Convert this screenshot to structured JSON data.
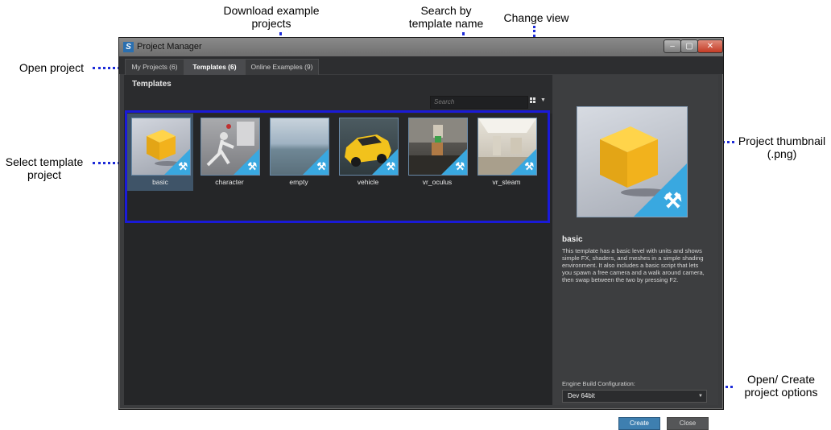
{
  "callouts": {
    "download": "Download example\nprojects",
    "search": "Search by\ntemplate name",
    "change_view": "Change view",
    "open_project": "Open project",
    "select_template": "Select template\nproject",
    "thumbnail": "Project thumbnail\n(.png)",
    "open_create": "Open/ Create\nproject options"
  },
  "window": {
    "title": "Project Manager",
    "icon": "app-logo-icon",
    "controls": [
      "minimize-icon",
      "maximize-icon",
      "close-icon"
    ]
  },
  "tabs": [
    {
      "label": "My Projects (6)",
      "active": false
    },
    {
      "label": "Templates (6)",
      "active": true
    },
    {
      "label": "Online Examples (9)",
      "active": false
    }
  ],
  "left": {
    "heading": "Templates",
    "search_placeholder": "Search",
    "view_icon": "grid-view-icon"
  },
  "templates": [
    {
      "label": "basic",
      "selected": true
    },
    {
      "label": "character",
      "selected": false
    },
    {
      "label": "empty",
      "selected": false
    },
    {
      "label": "vehicle",
      "selected": false
    },
    {
      "label": "vr_oculus",
      "selected": false
    },
    {
      "label": "vr_steam",
      "selected": false
    }
  ],
  "details": {
    "title": "basic",
    "description": "This template has a basic level with units and shows simple FX, shaders, and meshes in a simple shading environment. It also includes a basic script that lets you spawn a free camera and a walk around camera, then swap between the two by pressing F2.",
    "engine_label": "Engine Build Configuration:",
    "engine_value": "Dev 64bit",
    "create_label": "Create",
    "close_label": "Close"
  },
  "colors": {
    "accent_blue": "#39a8e0",
    "callout_blue": "#1d2bd8",
    "cube_yellow": "#f2b21c"
  }
}
